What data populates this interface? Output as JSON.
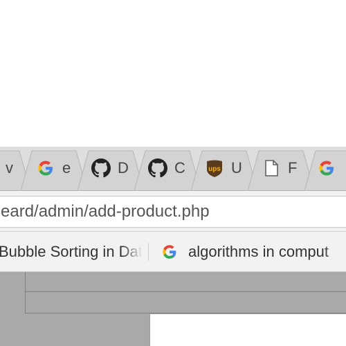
{
  "browser": {
    "tabs": [
      {
        "title": "v",
        "icon": "document-icon"
      },
      {
        "title": "e",
        "icon": "google-icon"
      },
      {
        "title": "D",
        "icon": "github-icon"
      },
      {
        "title": "C",
        "icon": "github-icon"
      },
      {
        "title": "U",
        "icon": "ups-icon"
      },
      {
        "title": "F",
        "icon": "document-icon"
      },
      {
        "title": "",
        "icon": "google-icon"
      }
    ],
    "address_bar": {
      "url": "eard/admin/add-product.php"
    },
    "bookmarks": [
      {
        "label": "Bubble Sorting in Dat",
        "icon": "none"
      },
      {
        "label": "algorithms in comput",
        "icon": "google-icon"
      }
    ]
  },
  "colors": {
    "tabstrip": "#dedede",
    "tab": "#cfcfcf",
    "toolbar": "#f2f2f2",
    "page_backdrop": "#a9a9a9",
    "google_blue": "#4285F4",
    "google_red": "#EA4335",
    "google_yellow": "#FBBC05",
    "google_green": "#34A853",
    "ups_brown": "#5a3b1b",
    "ups_gold": "#f2b400"
  }
}
